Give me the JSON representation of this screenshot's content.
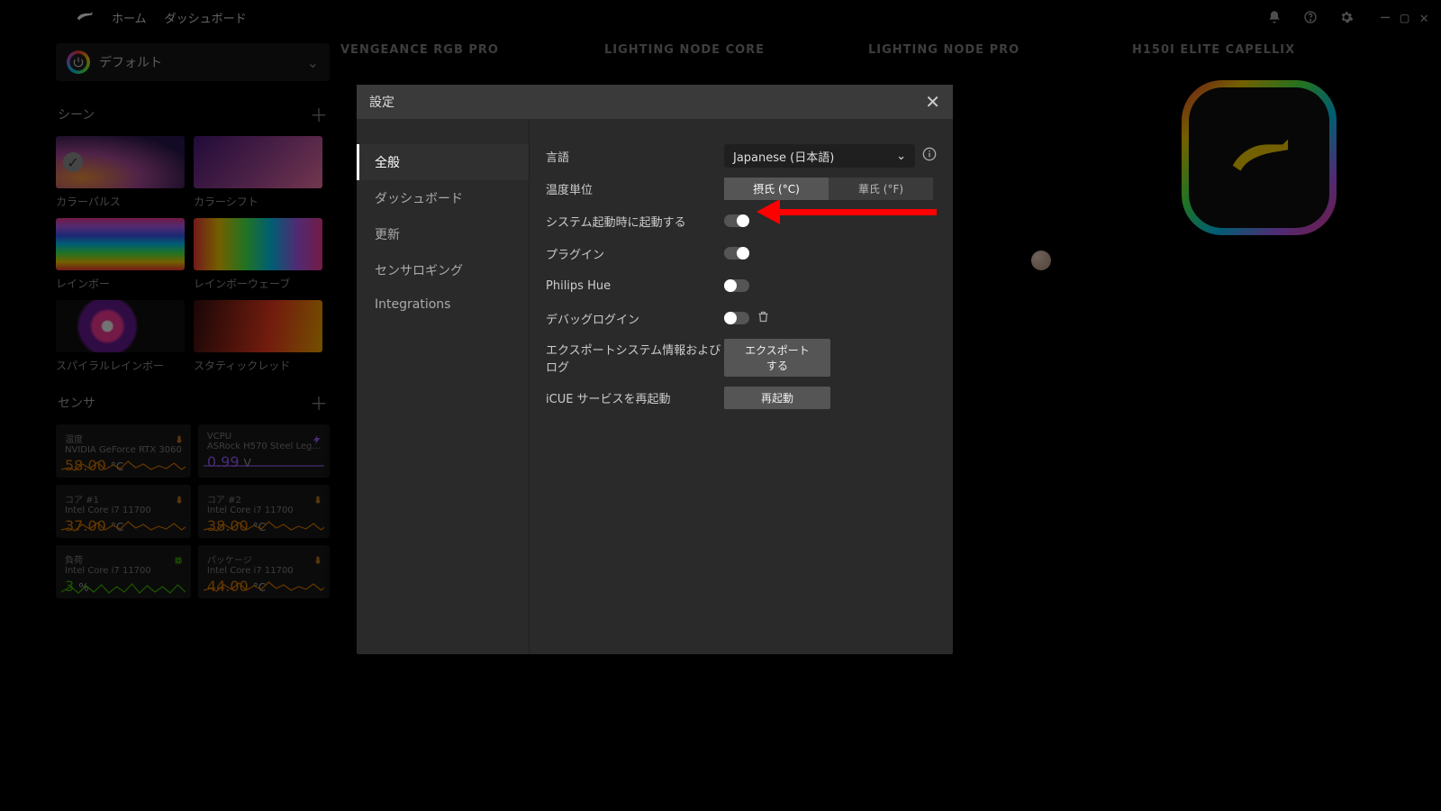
{
  "nav": {
    "home": "ホーム",
    "dashboard": "ダッシュボード"
  },
  "profile": {
    "name": "デフォルト"
  },
  "sections": {
    "scenes": "シーン",
    "sensors": "センサ"
  },
  "scenes": [
    {
      "label": "カラーパルス"
    },
    {
      "label": "カラーシフト"
    },
    {
      "label": "レインボー"
    },
    {
      "label": "レインボーウェーブ"
    },
    {
      "label": "スパイラルレインボー"
    },
    {
      "label": "スタティックレッド"
    }
  ],
  "devices": {
    "v": "VENGEANCE RGB PRO",
    "lncore": "LIGHTING NODE CORE",
    "lnpro": "LIGHTING NODE PRO",
    "h150": "H150I ELITE CAPELLIX"
  },
  "sensors": [
    {
      "t": "温度",
      "sub": "NVIDIA GeForce RTX 3060",
      "val": "58.00",
      "unit": "°C",
      "color": "#e07b00",
      "spark": "orange"
    },
    {
      "t": "VCPU",
      "sub": "ASRock H570 Steel Leg…",
      "val": "0.99",
      "unit": "V",
      "color": "#a060ff",
      "spark": "purple",
      "ico": "bolt"
    },
    {
      "t": "コア #1",
      "sub": "Intel Core i7 11700",
      "val": "37.00",
      "unit": "°C",
      "color": "#e07b00",
      "spark": "orange"
    },
    {
      "t": "コア #2",
      "sub": "Intel Core i7 11700",
      "val": "38.00",
      "unit": "°C",
      "color": "#e07b00",
      "spark": "orange"
    },
    {
      "t": "負荷",
      "sub": "Intel Core i7 11700",
      "val": "3",
      "unit": "%",
      "color": "#3fbf00",
      "spark": "green",
      "ico": "cpu"
    },
    {
      "t": "パッケージ",
      "sub": "Intel Core i7 11700",
      "val": "44.00",
      "unit": "°C",
      "color": "#e07b00",
      "spark": "orange"
    }
  ],
  "modal": {
    "title": "設定",
    "tabs": {
      "general": "全般",
      "dashboard": "ダッシュボード",
      "update": "更新",
      "sensorlog": "センサロギング",
      "integrations": "Integrations"
    },
    "labels": {
      "lang": "言語",
      "temp": "温度単位",
      "startup": "システム起動時に起動する",
      "plugin": "プラグイン",
      "hue": "Philips Hue",
      "debug": "デバッグログイン",
      "export": "エクスポートシステム情報およびログ",
      "restart": "iCUE サービスを再起動"
    },
    "langval": "Japanese (日本語)",
    "tempseg": {
      "c": "摂氏 (°C)",
      "f": "華氏 (°F)"
    },
    "exportbtn": "エクスポートする",
    "restartbtn": "再起動"
  }
}
